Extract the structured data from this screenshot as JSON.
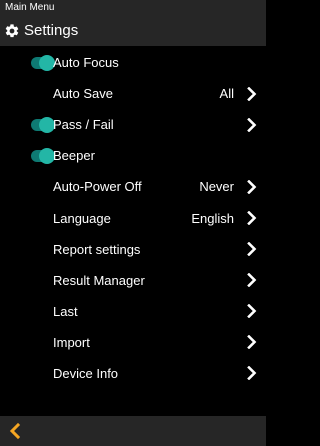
{
  "header": {
    "breadcrumb": "Main Menu",
    "title": "Settings",
    "icon": "gear-icon"
  },
  "colors": {
    "accent": "#f5a623",
    "toggle_on": "#23b6a6",
    "bar_bg": "#262626",
    "bg": "#000000"
  },
  "settings": {
    "items": [
      {
        "label": "Auto Focus",
        "toggle": true,
        "toggle_state": "on"
      },
      {
        "label": "Auto Save",
        "value": "All",
        "chevron": true
      },
      {
        "label": "Pass / Fail",
        "toggle": true,
        "toggle_state": "on",
        "chevron": true
      },
      {
        "label": "Beeper",
        "toggle": true,
        "toggle_state": "on"
      },
      {
        "label": "Auto-Power Off",
        "value": "Never",
        "chevron": true
      },
      {
        "label": "Language",
        "value": "English",
        "chevron": true
      },
      {
        "label": "Report settings",
        "chevron": true
      },
      {
        "label": "Result Manager",
        "chevron": true
      },
      {
        "label": "Last",
        "chevron": true
      },
      {
        "label": "Import",
        "chevron": true
      },
      {
        "label": "Device Info",
        "chevron": true
      }
    ]
  },
  "footer": {
    "back_icon": "chevron-left-icon"
  }
}
